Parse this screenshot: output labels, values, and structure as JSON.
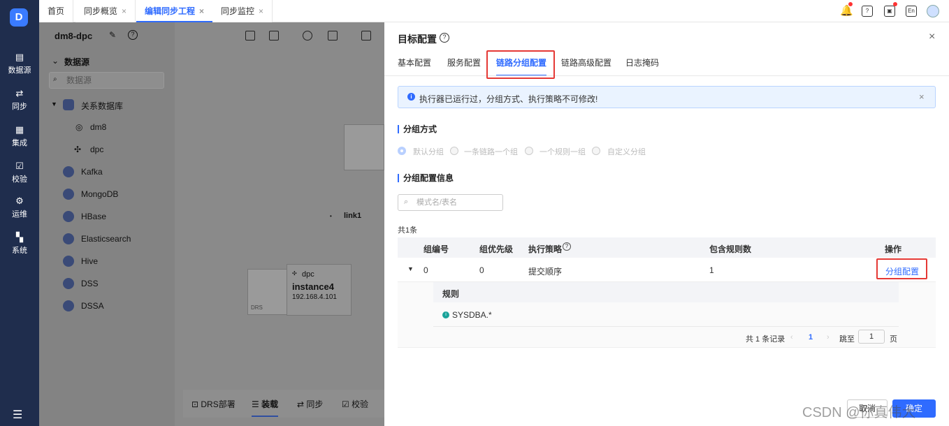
{
  "rail": {
    "items": [
      "数据源",
      "同步",
      "集成",
      "校验",
      "运维",
      "系统"
    ]
  },
  "tabs": [
    {
      "label": "首页"
    },
    {
      "label": "同步概览"
    },
    {
      "label": "编辑同步工程"
    },
    {
      "label": "同步监控"
    }
  ],
  "header_icons": {
    "lang": "En",
    "doc": "?"
  },
  "workspace": {
    "project": "dm8-dpc",
    "tree_title": "数据源",
    "search_placeholder": "数据源",
    "group": "关系数据库",
    "children": [
      "dm8",
      "dpc"
    ],
    "sources": [
      "Kafka",
      "MongoDB",
      "HBase",
      "Elasticsearch",
      "Hive",
      "DSS",
      "DSSA"
    ],
    "link": "link1",
    "node": {
      "db": "dpc",
      "name": "instance4",
      "ip": "192.168.4.101",
      "tag": "DRS"
    },
    "bottom": [
      "DRS部署",
      "装载",
      "同步",
      "校验"
    ]
  },
  "drawer": {
    "title": "目标配置",
    "tabs": [
      "基本配置",
      "服务配置",
      "链路分组配置",
      "链路高级配置",
      "日志掩码"
    ],
    "alert": "执行器已运行过，分组方式、执行策略不可修改!",
    "group_mode_label": "分组方式",
    "modes": [
      "默认分组",
      "一条链路一个组",
      "一个规则一组",
      "自定义分组"
    ],
    "info_label": "分组配置信息",
    "filter_placeholder": "模式名/表名",
    "total": "共1条",
    "headers": [
      "组编号",
      "组优先级",
      "执行策略",
      "包含规则数",
      "操作"
    ],
    "row": {
      "id": "0",
      "priority": "0",
      "strategy": "提交顺序",
      "rules": "1",
      "action": "分组配置"
    },
    "sub_header": "规则",
    "rule": "SYSDBA.*",
    "pagination": {
      "total": "共 1 条记录",
      "page": "1",
      "goto": "跳至",
      "input": "1",
      "unit": "页"
    },
    "cancel": "取消",
    "ok": "确定"
  },
  "watermark": "CSDN @你真伟大"
}
